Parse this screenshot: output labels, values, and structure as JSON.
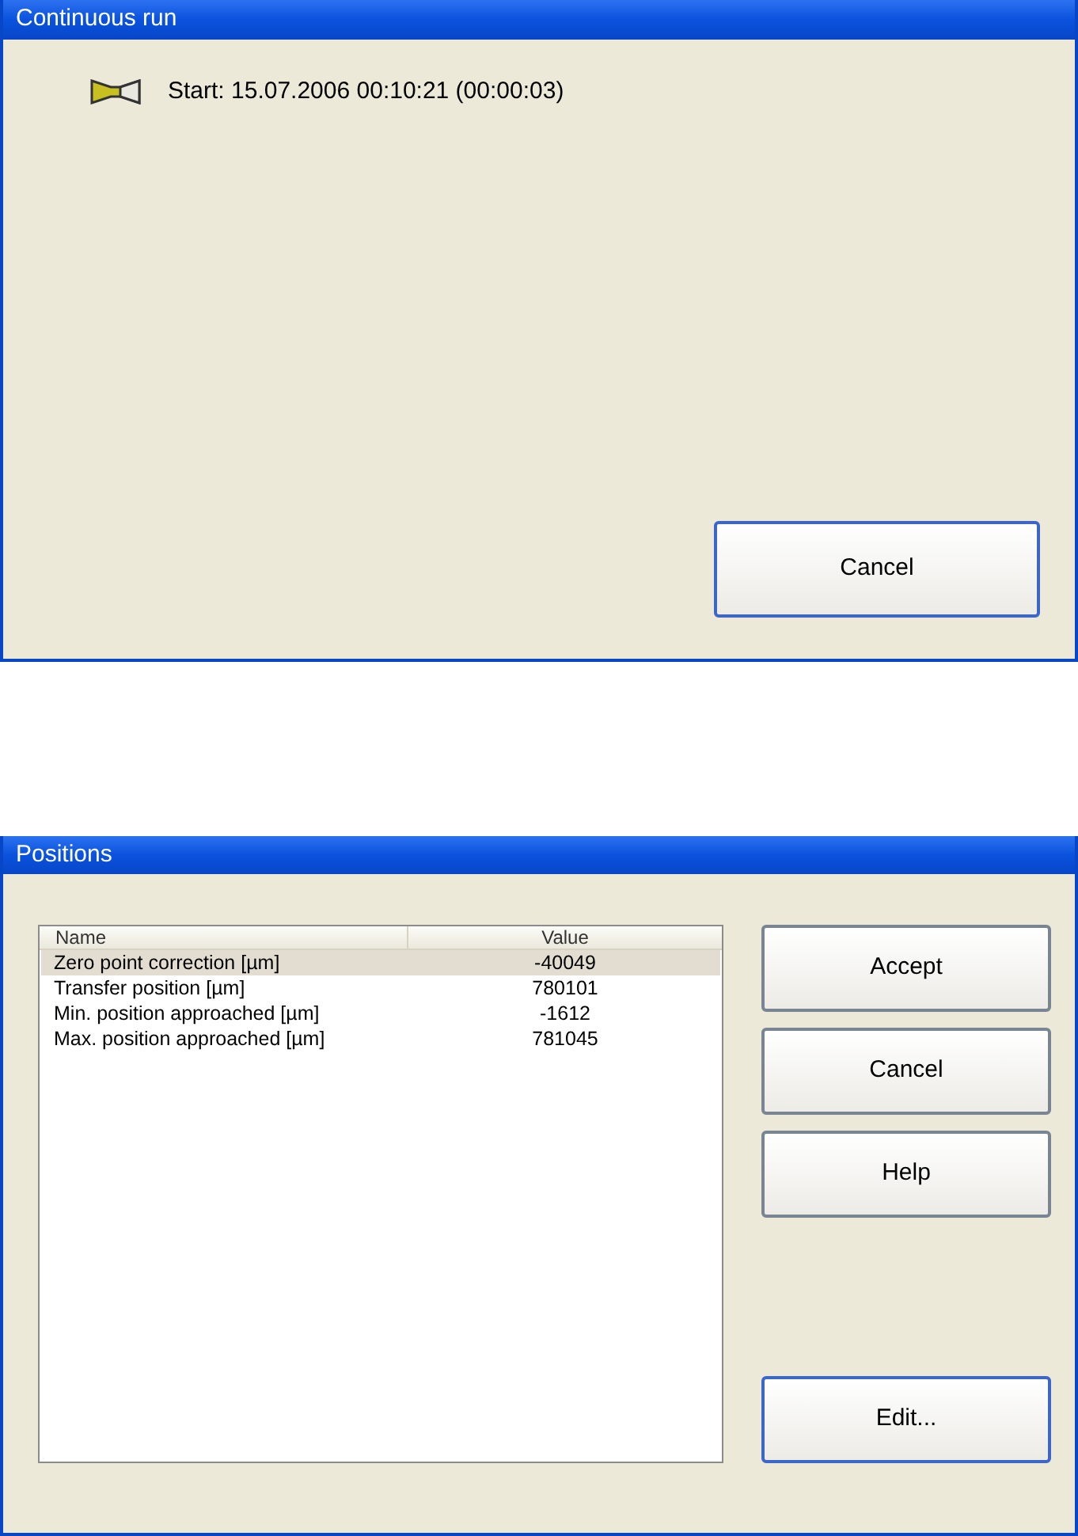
{
  "progress_dialog": {
    "title": "Continuous run",
    "status": "Start: 15.07.2006 00:10:21 (00:00:03)",
    "buttons": [
      {
        "label": "Cancel",
        "default": true
      }
    ]
  },
  "positions_dialog": {
    "title": "Positions",
    "table": {
      "columns": [
        "Name",
        "Value"
      ],
      "rows": [
        {
          "name": "Zero point correction [µm]",
          "value": "-40049",
          "selected": true
        },
        {
          "name": "Transfer position [µm]",
          "value": "780101",
          "selected": false
        },
        {
          "name": "Min. position approached [µm]",
          "value": "-1612",
          "selected": false
        },
        {
          "name": "Max. position approached [µm]",
          "value": "781045",
          "selected": false
        }
      ]
    },
    "buttons": [
      {
        "label": "Accept",
        "default": false
      },
      {
        "label": "Cancel",
        "default": false
      },
      {
        "label": "Help",
        "default": false
      },
      {
        "label": "Edit...",
        "default": true
      }
    ]
  }
}
